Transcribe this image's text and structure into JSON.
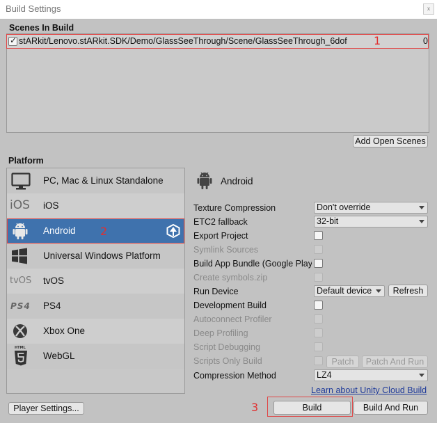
{
  "window": {
    "title": "Build Settings",
    "close_glyph": "x"
  },
  "scenes": {
    "header": "Scenes In Build",
    "items": [
      {
        "checked": true,
        "path": "stARkit/Lenovo.stARkit.SDK/Demo/GlassSeeThrough/Scene/GlassSeeThrough_6dof",
        "index": "0"
      }
    ],
    "add_open_scenes_label": "Add Open Scenes"
  },
  "platform": {
    "header": "Platform",
    "items": [
      {
        "name": "PC, Mac & Linux Standalone",
        "icon": "monitor-icon"
      },
      {
        "name": "iOS",
        "icon": "ios-icon",
        "icon_text": "iOS"
      },
      {
        "name": "Android",
        "icon": "android-icon",
        "selected": true
      },
      {
        "name": "Universal Windows Platform",
        "icon": "windows-icon"
      },
      {
        "name": "tvOS",
        "icon": "tvos-icon",
        "icon_text": "tvOS"
      },
      {
        "name": "PS4",
        "icon": "ps4-icon",
        "icon_text": "PS4"
      },
      {
        "name": "Xbox One",
        "icon": "xbox-icon"
      },
      {
        "name": "WebGL",
        "icon": "html5-icon",
        "icon_text": "HTML"
      }
    ],
    "active_icon": "unity-logo-icon"
  },
  "android_settings": {
    "title": "Android",
    "texture_compression": {
      "label": "Texture Compression",
      "value": "Don't override"
    },
    "etc2_fallback": {
      "label": "ETC2 fallback",
      "value": "32-bit"
    },
    "export_project": {
      "label": "Export Project",
      "checked": false
    },
    "symlink_sources": {
      "label": "Symlink Sources",
      "checked": false
    },
    "build_app_bundle": {
      "label": "Build App Bundle (Google Play)",
      "checked": false
    },
    "create_symbols": {
      "label": "Create symbols.zip",
      "checked": false
    },
    "run_device": {
      "label": "Run Device",
      "value": "Default device",
      "refresh_label": "Refresh"
    },
    "development_build": {
      "label": "Development Build",
      "checked": false
    },
    "autoconnect_profiler": {
      "label": "Autoconnect Profiler",
      "checked": false
    },
    "deep_profiling": {
      "label": "Deep Profiling",
      "checked": false
    },
    "script_debugging": {
      "label": "Script Debugging",
      "checked": false
    },
    "scripts_only_build": {
      "label": "Scripts Only Build",
      "checked": false,
      "patch_label": "Patch",
      "patch_and_run_label": "Patch And Run"
    },
    "compression_method": {
      "label": "Compression Method",
      "value": "LZ4"
    },
    "cloud_build_link": "Learn about Unity Cloud Build"
  },
  "footer": {
    "player_settings_label": "Player Settings...",
    "build_label": "Build",
    "build_and_run_label": "Build And Run"
  },
  "annotations": {
    "n1": "1",
    "n2": "2",
    "n3": "3"
  },
  "colors": {
    "accent": "#3f72ad",
    "annotation": "#e03030",
    "panel": "#c2c2c2"
  }
}
